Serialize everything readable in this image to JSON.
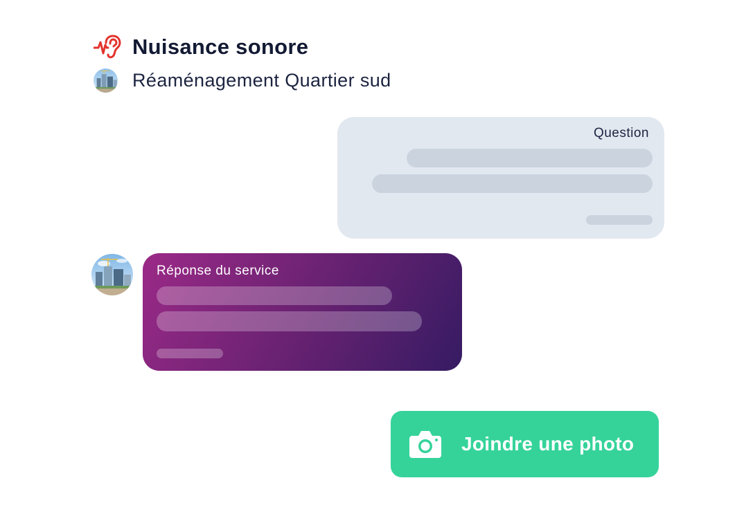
{
  "header": {
    "title": "Nuisance sonore",
    "title_icon": "ear-sound-icon",
    "project_name": "Réaménagement Quartier sud",
    "project_avatar": "city-skyline-avatar"
  },
  "conversation": {
    "question": {
      "label": "Question"
    },
    "answer": {
      "label": "Réponse du service",
      "avatar": "city-skyline-avatar"
    }
  },
  "actions": {
    "attach_photo_label": "Joindre une photo",
    "attach_photo_icon": "camera-icon"
  },
  "colors": {
    "title_icon": "#e2342d",
    "question_bubble": "#e2e8f0",
    "answer_gradient_start": "#9b2a87",
    "answer_gradient_end": "#361b63",
    "attach_button": "#35d39a"
  }
}
